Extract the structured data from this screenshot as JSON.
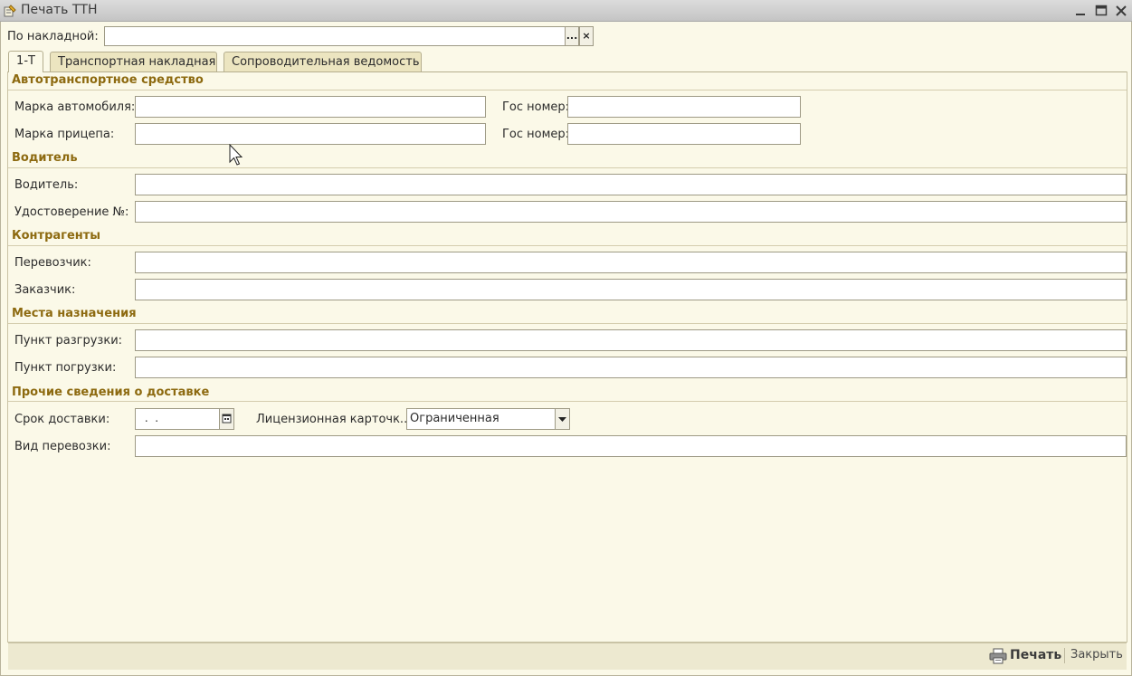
{
  "window": {
    "title": "Печать ТТН",
    "controls": [
      "minimize-icon",
      "maximize-icon",
      "close-icon"
    ]
  },
  "header": {
    "invoice_label": "По накладной:",
    "invoice_value": "",
    "select_button": "...",
    "clear_button": "×"
  },
  "tabs": [
    {
      "label": "1-Т",
      "active": true
    },
    {
      "label": "Транспортная накладная",
      "active": false
    },
    {
      "label": "Сопроводительная ведомость",
      "active": false
    }
  ],
  "groups": {
    "vehicle": {
      "title": "Автотранспортное средство",
      "car_brand_label": "Марка автомобиля:",
      "car_brand_value": "",
      "car_plate_label": "Гос номер:",
      "car_plate_value": "",
      "trailer_brand_label": "Марка прицепа:",
      "trailer_brand_value": "",
      "trailer_plate_label": "Гос номер:",
      "trailer_plate_value": ""
    },
    "driver": {
      "title": "Водитель",
      "driver_label": "Водитель:",
      "driver_value": "",
      "license_label": "Удостоверение №:",
      "license_value": ""
    },
    "counterparties": {
      "title": "Контрагенты",
      "carrier_label": "Перевозчик:",
      "carrier_value": "",
      "customer_label": "Заказчик:",
      "customer_value": ""
    },
    "destinations": {
      "title": "Места назначения",
      "unloading_label": "Пункт разгрузки:",
      "unloading_value": "",
      "loading_label": "Пункт погрузки:",
      "loading_value": ""
    },
    "other": {
      "title": "Прочие сведения о доставке",
      "delivery_date_label": "Срок доставки:",
      "delivery_date_value": " .  .",
      "license_card_label": "Лицензионная карточк...",
      "license_card_value": "Ограниченная",
      "transport_type_label": "Вид перевозки:",
      "transport_type_value": ""
    }
  },
  "footer": {
    "print_label": "Печать",
    "close_label": "Закрыть"
  },
  "colors": {
    "background": "#fbf9e8",
    "group_title": "#8d6a10",
    "tab_inactive": "#ece5c0",
    "field_border": "#9e9a85"
  }
}
